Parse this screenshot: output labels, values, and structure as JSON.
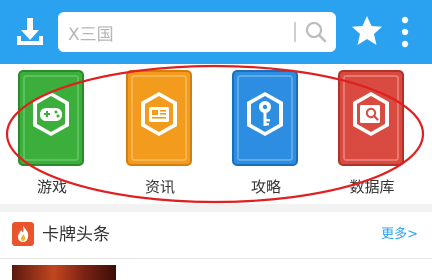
{
  "header": {
    "search_value": "X三国",
    "colors": {
      "bar": "#2aa2f0"
    },
    "icons": [
      "download-icon",
      "search-icon",
      "star-icon",
      "more-vertical-icon"
    ]
  },
  "categories": [
    {
      "label": "游戏",
      "icon": "gamepad-icon",
      "color": "#3cae3c"
    },
    {
      "label": "资讯",
      "icon": "news-icon",
      "color": "#f39b1c"
    },
    {
      "label": "攻略",
      "icon": "key-icon",
      "color": "#2d8de0"
    },
    {
      "label": "数据库",
      "icon": "database-search-icon",
      "color": "#d94b40"
    }
  ],
  "news_section": {
    "title": "卡牌头条",
    "more_label": "更多>",
    "icon": "fire-icon"
  },
  "annotation": {
    "shape": "ellipse",
    "color": "#e02020"
  }
}
